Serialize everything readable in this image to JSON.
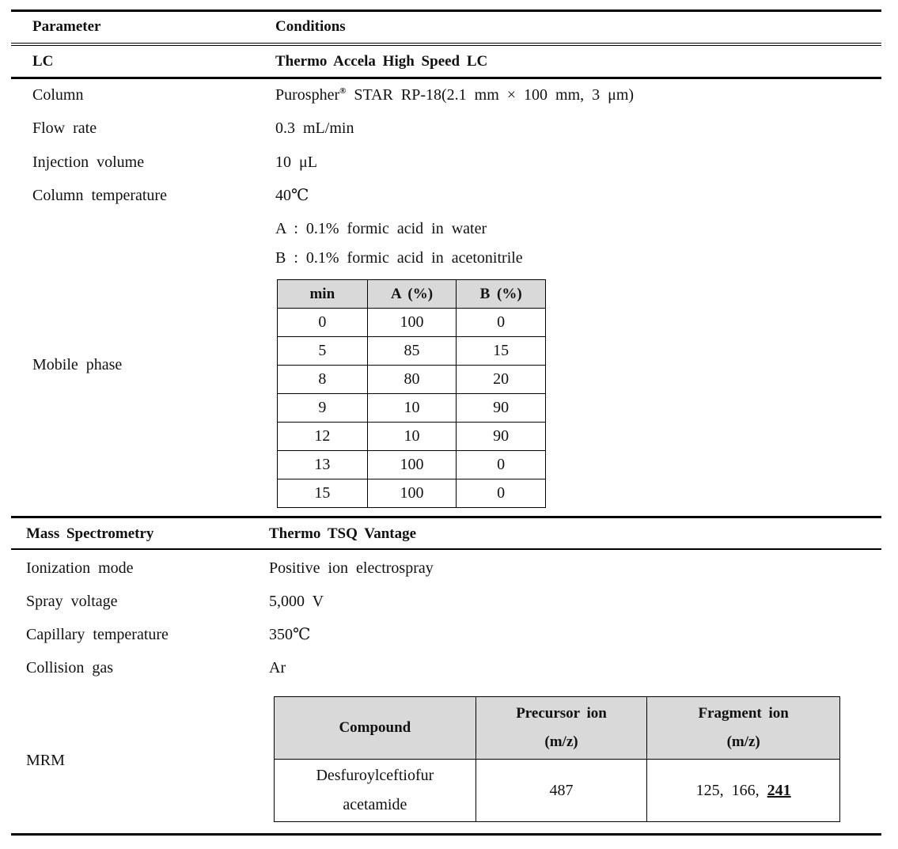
{
  "header": {
    "parameter": "Parameter",
    "conditions": "Conditions"
  },
  "lc": {
    "section_label": "LC",
    "instrument": "Thermo Accela High Speed LC",
    "rows": [
      {
        "label": "Column",
        "value_prefix": "Purospher",
        "value_sup": "®",
        "value_suffix": " STAR RP-18(2.1 mm × 100 mm, 3 μm)"
      },
      {
        "label": "Flow rate",
        "value": "0.3 mL/min"
      },
      {
        "label": "Injection volume",
        "value": "10 μL"
      },
      {
        "label": "Column temperature",
        "value": "40℃"
      }
    ],
    "mobile_phase": {
      "label": "Mobile phase",
      "solvent_a": "A : 0.1% formic acid in water",
      "solvent_b": "B : 0.1% formic acid in acetonitrile",
      "gradient_table": {
        "headers": [
          "min",
          "A (%)",
          "B (%)"
        ],
        "rows": [
          [
            "0",
            "100",
            "0"
          ],
          [
            "5",
            "85",
            "15"
          ],
          [
            "8",
            "80",
            "20"
          ],
          [
            "9",
            "10",
            "90"
          ],
          [
            "12",
            "10",
            "90"
          ],
          [
            "13",
            "100",
            "0"
          ],
          [
            "15",
            "100",
            "0"
          ]
        ]
      }
    }
  },
  "ms": {
    "section_label": "Mass Spectrometry",
    "instrument": "Thermo TSQ Vantage",
    "rows": [
      {
        "label": "Ionization mode",
        "value": "Positive ion electrospray"
      },
      {
        "label": "Spray voltage",
        "value": "5,000 V"
      },
      {
        "label": "Capillary temperature",
        "value": "350℃"
      },
      {
        "label": "Collision gas",
        "value": "Ar"
      }
    ],
    "mrm": {
      "label": "MRM",
      "headers": {
        "compound": "Compound",
        "precursor_line1": "Precursor ion",
        "precursor_line2": "(m/z)",
        "fragment_line1": "Fragment ion",
        "fragment_line2": "(m/z)"
      },
      "row": {
        "compound_line1": "Desfuroylceftiofur",
        "compound_line2": "acetamide",
        "precursor": "487",
        "fragments_plain": "125, 166, ",
        "fragment_quant": "241"
      }
    }
  }
}
